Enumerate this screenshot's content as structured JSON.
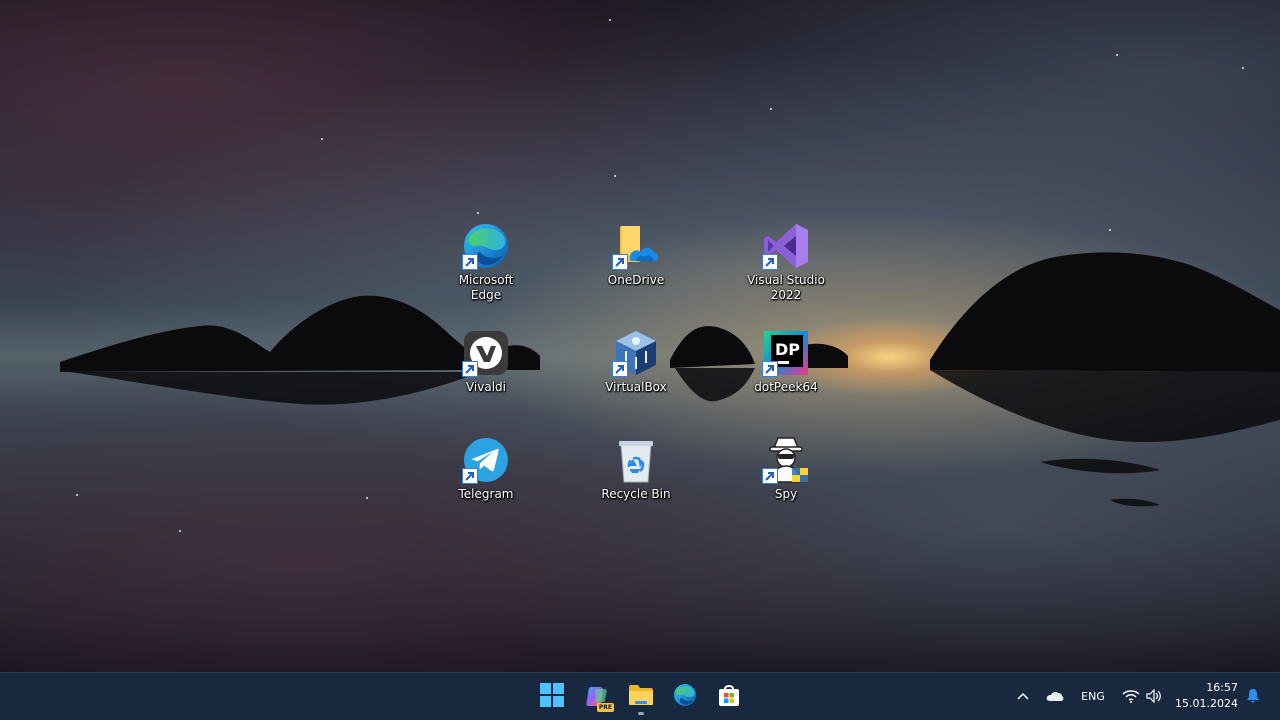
{
  "desktop": {
    "icons": [
      {
        "label": "Microsoft Edge",
        "line1": "Microsoft",
        "line2": "Edge",
        "icon": "edge-icon",
        "shortcut": true
      },
      {
        "label": "OneDrive",
        "line1": "OneDrive",
        "line2": "",
        "icon": "onedrive-folder-icon",
        "shortcut": true
      },
      {
        "label": "Visual Studio 2022",
        "line1": "Visual Studio",
        "line2": "2022",
        "icon": "visual-studio-icon",
        "shortcut": true
      },
      {
        "label": "Vivaldi",
        "line1": "Vivaldi",
        "line2": "",
        "icon": "vivaldi-icon",
        "shortcut": true
      },
      {
        "label": "VirtualBox",
        "line1": "VirtualBox",
        "line2": "",
        "icon": "virtualbox-icon",
        "shortcut": true
      },
      {
        "label": "dotPeek64",
        "line1": "dotPeek64",
        "line2": "",
        "icon": "dotpeek-icon",
        "shortcut": true
      },
      {
        "label": "Telegram",
        "line1": "Telegram",
        "line2": "",
        "icon": "telegram-icon",
        "shortcut": true
      },
      {
        "label": "Recycle Bin",
        "line1": "Recycle Bin",
        "line2": "",
        "icon": "recycle-bin-icon",
        "shortcut": false
      },
      {
        "label": "Spy",
        "line1": "Spy",
        "line2": "",
        "icon": "spy-icon",
        "shortcut": true
      }
    ],
    "dotpeek_badge": "DP"
  },
  "taskbar": {
    "apps": [
      {
        "name": "Start",
        "icon": "windows-start-icon"
      },
      {
        "name": "Copilot",
        "icon": "copilot-icon",
        "badge": "PRE"
      },
      {
        "name": "File Explorer",
        "icon": "file-explorer-icon",
        "active": true
      },
      {
        "name": "Microsoft Edge",
        "icon": "edge-icon"
      },
      {
        "name": "Microsoft Store",
        "icon": "store-icon"
      }
    ],
    "tray": {
      "chevron": "^",
      "language": "ENG",
      "time": "16:57",
      "date": "15.01.2024"
    }
  },
  "colors": {
    "taskbar_bg": "#18283e",
    "accent": "#0078d4"
  }
}
